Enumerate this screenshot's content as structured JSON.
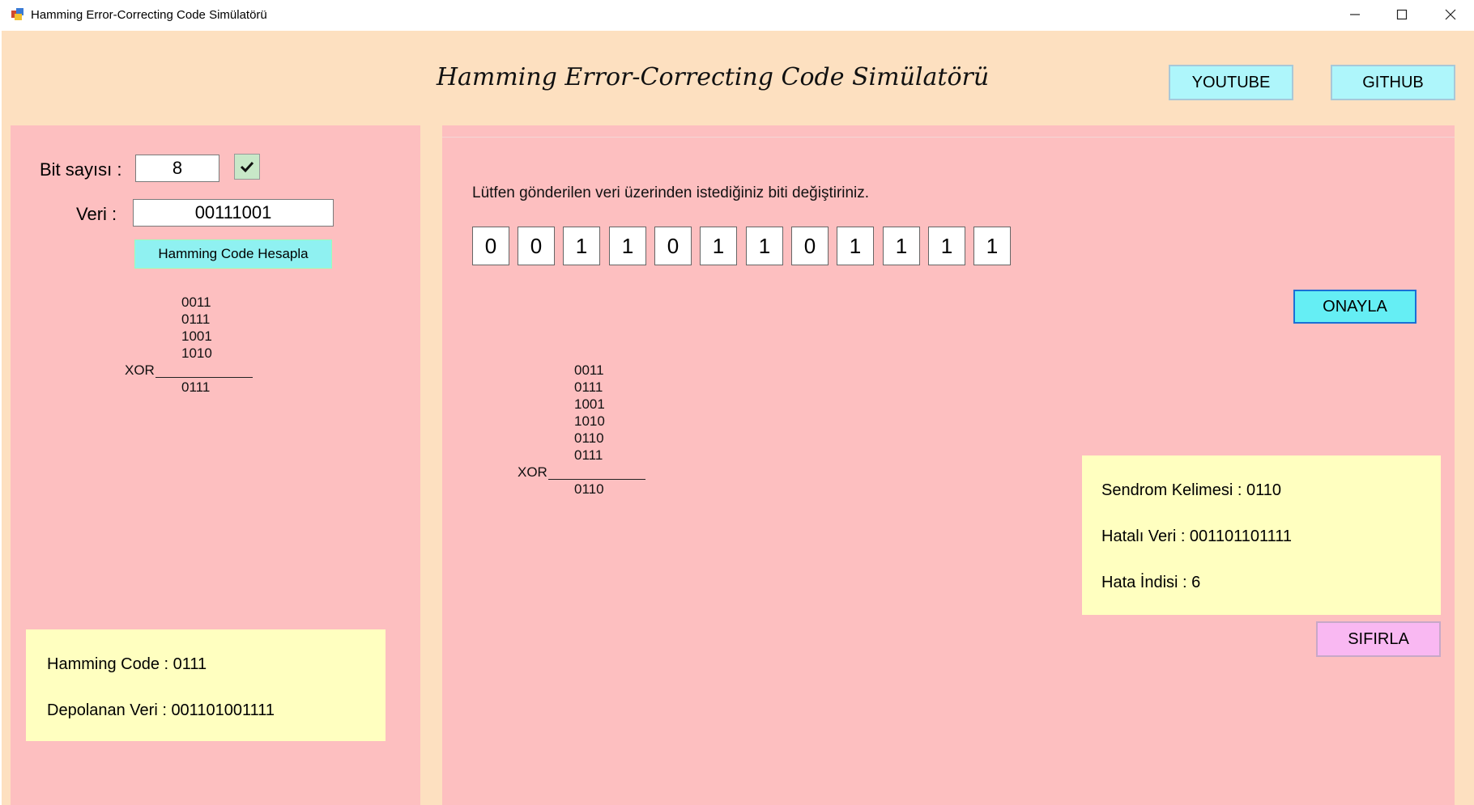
{
  "window": {
    "title": "Hamming Error-Correcting Code Simülatörü"
  },
  "header": {
    "heading": "Hamming Error-Correcting Code Simülatörü",
    "youtube_label": "YOUTUBE",
    "github_label": "GITHUB"
  },
  "left": {
    "bit_count_label": "Bit sayısı :",
    "bit_count_value": "8",
    "data_label": "Veri :",
    "data_value": "00111001",
    "calc_label": "Hamming Code Hesapla",
    "xor_rows": [
      "0011",
      "0111",
      "1001",
      "1010"
    ],
    "xor_label": "XOR",
    "xor_result": "0111",
    "hamming_code_text": "Hamming Code : 0111",
    "stored_data_text": "Depolanan Veri : 001101001111"
  },
  "right": {
    "instruction": "Lütfen gönderilen veri üzerinden istediğiniz biti değiştiriniz.",
    "bits": [
      "0",
      "0",
      "1",
      "1",
      "0",
      "1",
      "1",
      "0",
      "1",
      "1",
      "1",
      "1"
    ],
    "confirm_label": "ONAYLA",
    "xor_rows": [
      "0011",
      "0111",
      "1001",
      "1010",
      "0110",
      "0111"
    ],
    "xor_label": "XOR",
    "xor_result": "0110",
    "syndrome_text": "Sendrom Kelimesi : 0110",
    "faulty_data_text": "Hatalı Veri : 001101101111",
    "error_index_text": "Hata İndisi : 6",
    "reset_label": "SIFIRLA"
  },
  "icons": {
    "check": "check-icon",
    "minimize": "minimize-icon",
    "maximize": "maximize-icon",
    "close": "close-icon"
  }
}
